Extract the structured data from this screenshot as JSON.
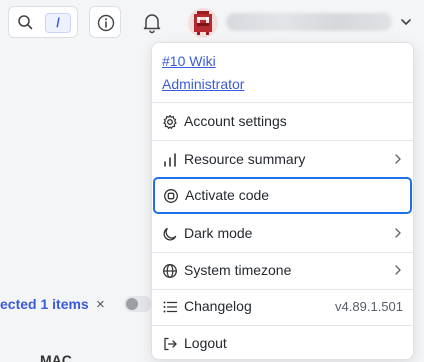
{
  "toolbar": {
    "search_shortcut": "/"
  },
  "filter": {
    "selected_text": "ected 1 items",
    "clear_symbol": "×",
    "column_header": "MAC"
  },
  "user_menu": {
    "site_link": "#10 Wiki",
    "role_link": "Administrator",
    "items": [
      {
        "label": "Account settings",
        "icon": "gear-icon"
      },
      {
        "label": "Resource summary",
        "icon": "bar-chart-icon"
      },
      {
        "label": "Activate code",
        "icon": "activate-code-icon"
      },
      {
        "label": "Dark mode",
        "icon": "moon-icon"
      },
      {
        "label": "System timezone",
        "icon": "globe-icon"
      },
      {
        "label": "Changelog",
        "icon": "list-icon",
        "version": "v4.89.1.501"
      },
      {
        "label": "Logout",
        "icon": "logout-icon"
      }
    ]
  },
  "colors": {
    "link": "#3b5bdb",
    "focus_border": "#1f6feb",
    "background": "#f4f5f7"
  }
}
